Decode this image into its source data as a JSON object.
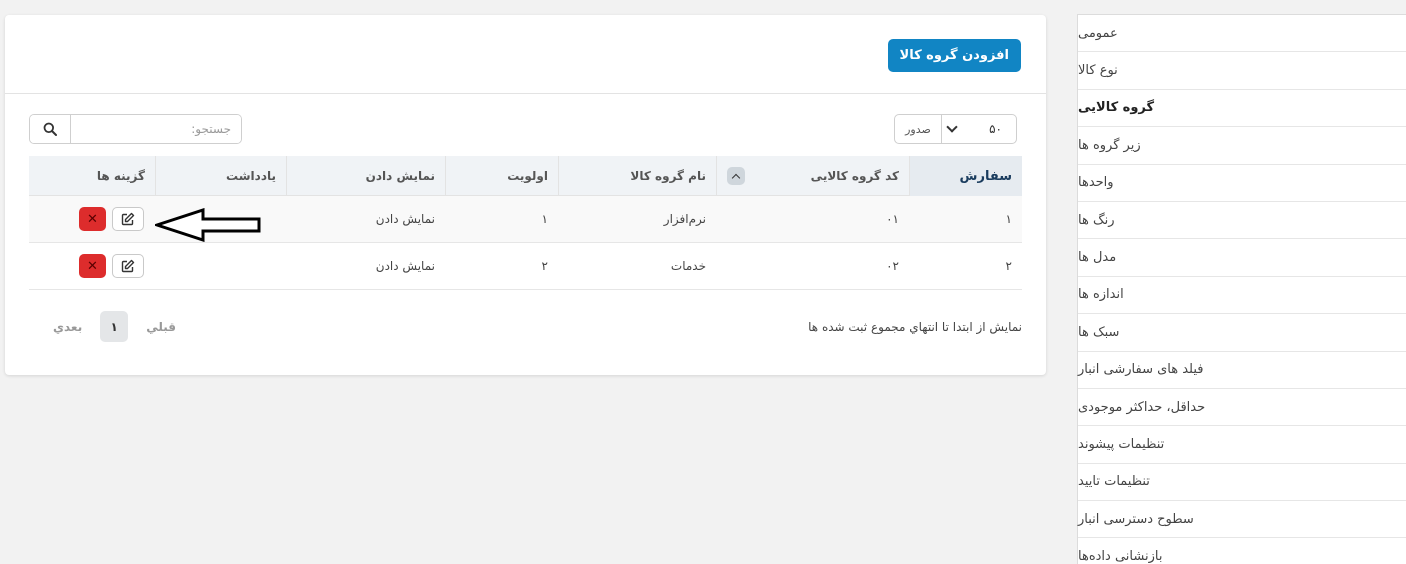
{
  "sidebar": {
    "items": [
      {
        "label": "عمومی"
      },
      {
        "label": "نوع کالا"
      },
      {
        "label": "گروه کالایی"
      },
      {
        "label": "زیر گروه ها"
      },
      {
        "label": "واحدها"
      },
      {
        "label": "رنگ ها"
      },
      {
        "label": "مدل ها"
      },
      {
        "label": "اندازه ها"
      },
      {
        "label": "سبک ها"
      },
      {
        "label": "فیلد های سفارشی انبار"
      },
      {
        "label": "حداقل، حداکثر موجودی"
      },
      {
        "label": "تنظیمات پیشوند"
      },
      {
        "label": "تنظیمات تایید"
      },
      {
        "label": "سطوح دسترسی انبار"
      },
      {
        "label": "بازنشانی داده‌ها"
      }
    ],
    "active_index": 2
  },
  "header": {
    "add_button": "افزودن گروه کالا"
  },
  "toolbar": {
    "search_placeholder": "جستجو:",
    "page_size": "۵۰",
    "export_label": "صدور"
  },
  "table": {
    "columns": [
      "سفارش",
      "کد گروه کالایی",
      "نام گروه کالا",
      "اولویت",
      "نمایش دادن",
      "یادداشت",
      "گزینه ها"
    ],
    "rows": [
      {
        "order": "۱",
        "code": "۰۱",
        "name": "نرم‌افزار",
        "priority": "۱",
        "display": "نمایش دادن",
        "note": ""
      },
      {
        "order": "۲",
        "code": "۰۲",
        "name": "خدمات",
        "priority": "۲",
        "display": "نمایش دادن",
        "note": ""
      }
    ]
  },
  "footer": {
    "info": "نمایش از ابتدا تا انتهاي مجموع ثبت شده ها",
    "prev": "قبلي",
    "page": "۱",
    "next": "بعدي"
  }
}
